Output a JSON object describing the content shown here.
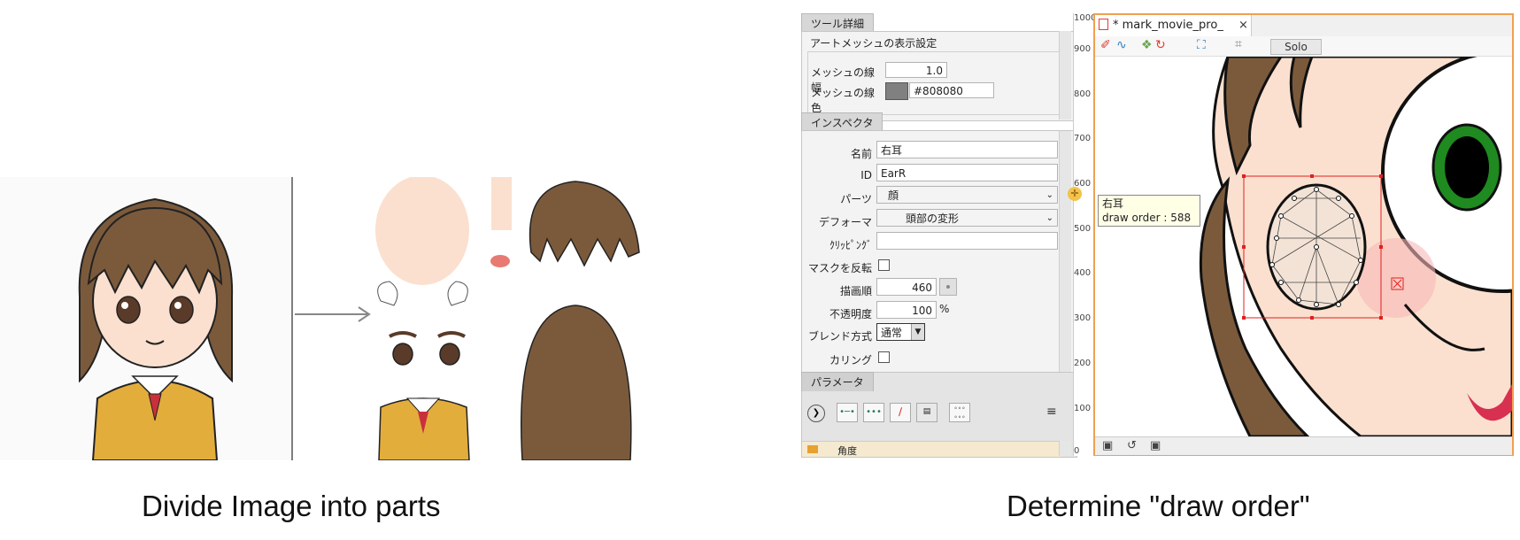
{
  "captions": {
    "left": "Divide Image into parts",
    "right": "Determine \"draw order\""
  },
  "tool_details": {
    "tab_label": "ツール詳細",
    "section_title": "アートメッシュの表示設定",
    "mesh_width_label": "メッシュの線幅",
    "mesh_width_value": "1.0",
    "mesh_color_label": "メッシュの線色",
    "mesh_color_value": "#808080",
    "mesh_color_swatch": "#808080"
  },
  "inspector": {
    "tab_label": "インスペクタ",
    "rows": {
      "name_label": "名前",
      "name_value": "右耳",
      "id_label": "ID",
      "id_value": "EarR",
      "parts_label": "パーツ",
      "parts_value": "顔",
      "deformer_label": "デフォーマ",
      "deformer_value": "頭部の変形",
      "clipping_label": "ｸﾘｯﾋﾟﾝｸﾞ",
      "clipping_value": "",
      "invert_mask_label": "マスクを反転",
      "draw_order_label": "描画順",
      "draw_order_value": "460",
      "opacity_label": "不透明度",
      "opacity_value": "100",
      "opacity_unit": "%",
      "blend_label": "ブレンド方式",
      "blend_value": "通常",
      "culling_label": "カリング"
    }
  },
  "parameters": {
    "tab_label": "パラメータ",
    "item_partial": "角度"
  },
  "ruler": {
    "ticks": [
      "1000",
      "900",
      "800",
      "700",
      "600",
      "500",
      "400",
      "300",
      "200",
      "100",
      "0"
    ]
  },
  "canvas": {
    "tab_title": "* mark_movie_pro_",
    "close_glyph": "×",
    "solo_label": "Solo",
    "tooltip_name": "右耳",
    "tooltip_draw_order": "draw order : 588"
  },
  "colors": {
    "accent_orange": "#f0a050",
    "hair_brown": "#7b5a3c",
    "skin": "#fbe0cf",
    "eye_green": "#1f8a1f",
    "selection_red": "#e02020"
  }
}
